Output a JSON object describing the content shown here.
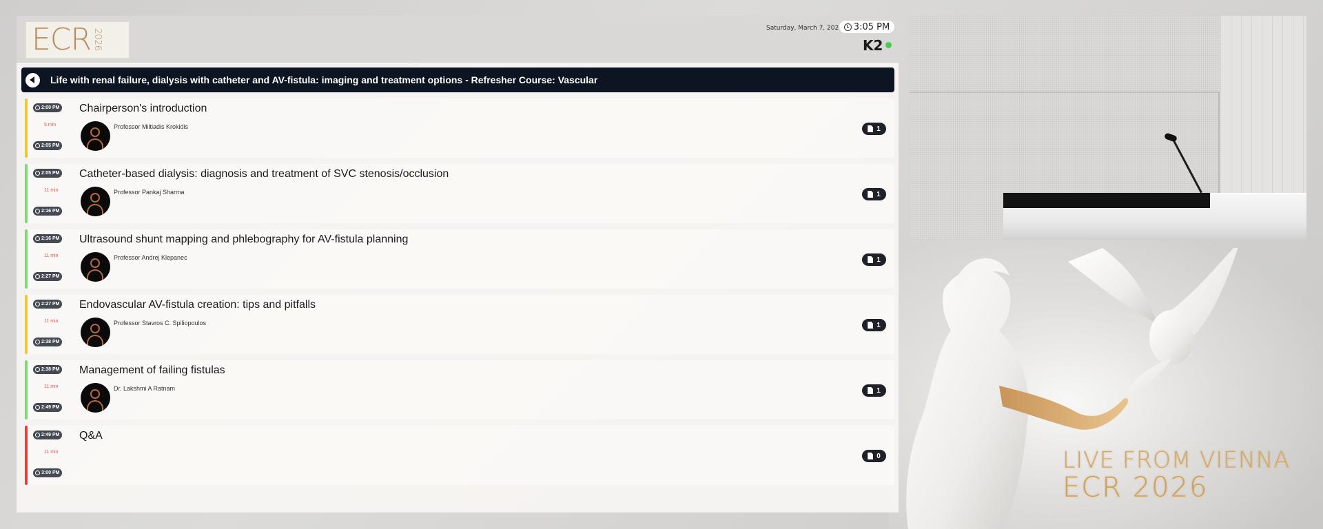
{
  "header": {
    "logo_main": "ECR",
    "logo_year": "2026",
    "date": "Saturday, March 7, 2026",
    "time": "3:05 PM",
    "room": "K2"
  },
  "session": {
    "title": "Life with renal failure, dialysis with catheter and AV-fistula: imaging and treatment options - Refresher Course: Vascular"
  },
  "talks": [
    {
      "start": "2:00 PM",
      "end": "2:05 PM",
      "duration": "5 min",
      "title": "Chairperson's introduction",
      "speaker": "Professor Miltiadis Krokidis",
      "docs": "1",
      "accent": "#f2c531"
    },
    {
      "start": "2:05 PM",
      "end": "2:16 PM",
      "duration": "11 min",
      "title": "Catheter-based dialysis: diagnosis and treatment of SVC stenosis/occlusion",
      "speaker": "Professor Pankaj Sharma",
      "docs": "1",
      "accent": "#7ed87a"
    },
    {
      "start": "2:16 PM",
      "end": "2:27 PM",
      "duration": "11 min",
      "title": "Ultrasound shunt mapping and phlebography for AV-fistula planning",
      "speaker": "Professor Andrej Klepanec",
      "docs": "1",
      "accent": "#7ed87a"
    },
    {
      "start": "2:27 PM",
      "end": "2:38 PM",
      "duration": "11 min",
      "title": "Endovascular AV-fistula creation: tips and pitfalls",
      "speaker": "Professor Stavros C. Spiliopoulos",
      "docs": "1",
      "accent": "#f2c531"
    },
    {
      "start": "2:38 PM",
      "end": "2:49 PM",
      "duration": "11 min",
      "title": "Management of failing fistulas",
      "speaker": "Dr. Lakshmi A Ratnam",
      "docs": "1",
      "accent": "#7ed87a"
    },
    {
      "start": "2:49 PM",
      "end": "3:00 PM",
      "duration": "11 min",
      "title": "Q&A",
      "speaker": "",
      "docs": "0",
      "accent": "#e0413a"
    }
  ],
  "branding": {
    "live_line": "LIVE FROM VIENNA",
    "event_line": "ECR 2026"
  }
}
